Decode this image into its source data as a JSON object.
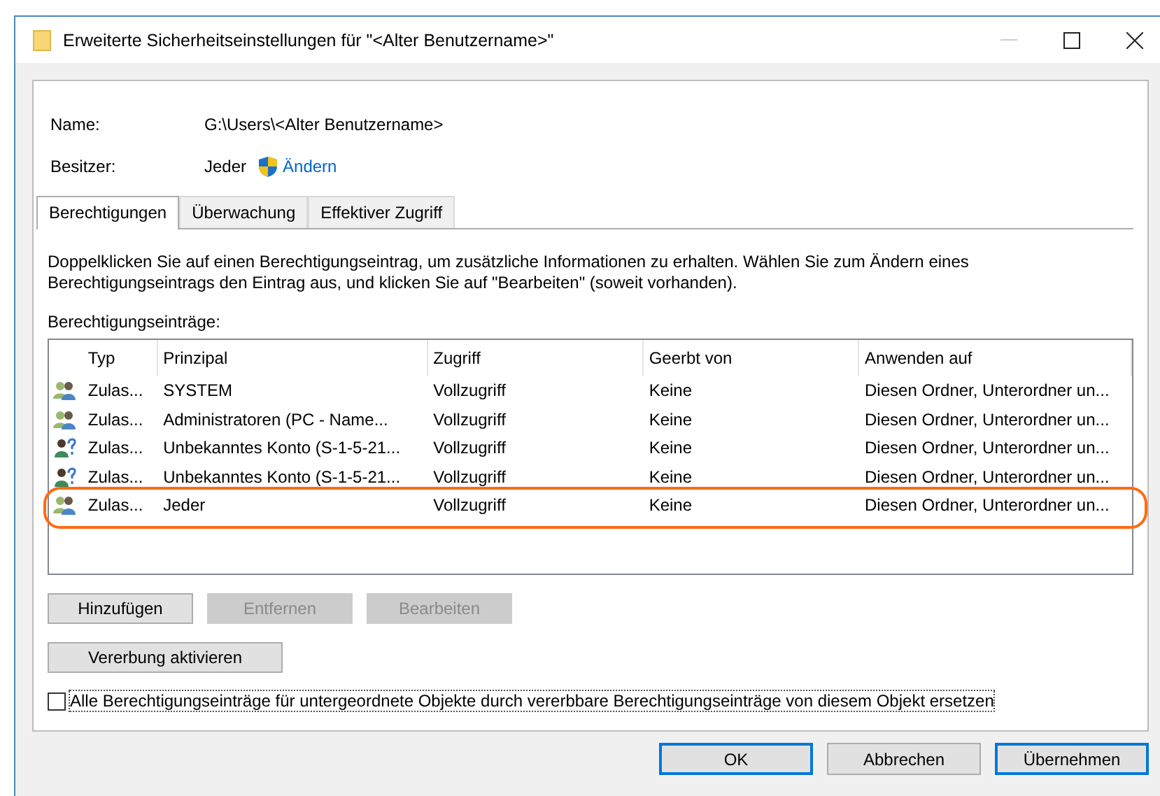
{
  "window": {
    "title": "Erweiterte Sicherheitseinstellungen für  \"<Alter Benutzername>\""
  },
  "info": [
    {
      "label": "Name:",
      "value": "G:\\Users\\<Alter Benutzername>"
    },
    {
      "label": "Besitzer:",
      "value": "Jeder",
      "link": {
        "label": "Ändern"
      }
    }
  ],
  "tabs": [
    {
      "label": "Berechtigungen",
      "selected": true
    },
    {
      "label": "Überwachung",
      "selected": false
    },
    {
      "label": "Effektiver Zugriff",
      "selected": false
    }
  ],
  "description": "Doppelklicken Sie auf einen Berechtigungseintrag, um zusätzliche Informationen zu erhalten. Wählen Sie zum Ändern eines Berechtigungseintrags den Eintrag aus, und klicken Sie auf \"Bearbeiten\" (soweit vorhanden).",
  "list_label": "Berechtigungseinträge:",
  "table": {
    "columns": [
      "Typ",
      "Prinzipal",
      "Zugriff",
      "Geerbt von",
      "Anwenden auf"
    ],
    "rows": [
      {
        "kind": "group",
        "cells": [
          "Zulas...",
          "SYSTEM",
          "Vollzugriff",
          "Keine",
          "Diesen Ordner, Unterordner un..."
        ],
        "highlighted": false
      },
      {
        "kind": "group",
        "cells": [
          "Zulas...",
          "Administratoren   (PC - Name...",
          "Vollzugriff",
          "Keine",
          "Diesen Ordner, Unterordner un..."
        ],
        "highlighted": false
      },
      {
        "kind": "unknown",
        "cells": [
          "Zulas...",
          "Unbekanntes Konto (S-1-5-21...",
          "Vollzugriff",
          "Keine",
          "Diesen Ordner, Unterordner un..."
        ],
        "highlighted": false
      },
      {
        "kind": "unknown",
        "cells": [
          "Zulas...",
          "Unbekanntes Konto (S-1-5-21...",
          "Vollzugriff",
          "Keine",
          "Diesen Ordner, Unterordner un..."
        ],
        "highlighted": false
      },
      {
        "kind": "group",
        "cells": [
          "Zulas...",
          "Jeder",
          "Vollzugriff",
          "Keine",
          "Diesen Ordner, Unterordner un..."
        ],
        "highlighted": true
      }
    ]
  },
  "action_buttons": [
    {
      "label": "Hinzufügen",
      "disabled": false
    },
    {
      "label": "Entfernen",
      "disabled": true
    },
    {
      "label": "Bearbeiten",
      "disabled": true
    }
  ],
  "inheritance_button": {
    "label": "Vererbung aktivieren"
  },
  "replace_checkbox": {
    "label": "Alle Berechtigungseinträge für untergeordnete Objekte durch vererbbare Berechtigungseinträge von diesem Objekt ersetzen",
    "checked": false
  },
  "dialog_buttons": [
    {
      "label": "OK",
      "default": true
    },
    {
      "label": "Abbrechen",
      "default": false
    },
    {
      "label": "Übernehmen",
      "default": true
    }
  ]
}
